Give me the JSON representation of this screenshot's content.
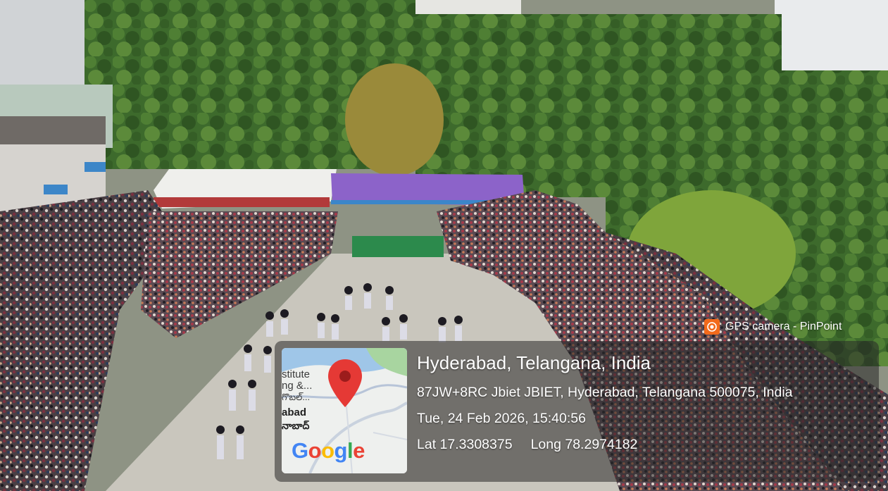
{
  "photo": {
    "description_icon": "aerial-event-photo"
  },
  "watermark": {
    "app_icon": "camera-lens-icon",
    "app_name": "GPS camera - PinPoint",
    "accent_color": "#f26a1b"
  },
  "map": {
    "labels": [
      "stitute",
      "ng &...",
      "గొబల్...",
      "abad",
      "నాబాద్"
    ],
    "logo_letters": [
      "G",
      "o",
      "o",
      "g",
      "l",
      "e"
    ],
    "pin_color": "#e53935"
  },
  "location": {
    "title": "Hyderabad, Telangana, India",
    "address": "87JW+8RC Jbiet JBIET, Hyderabad, Telangana 500075, India",
    "datetime": "Tue, 24 Feb 2026, 15:40:56",
    "lat_label": "Lat 17.3308375",
    "long_label": "Long 78.2974182"
  }
}
